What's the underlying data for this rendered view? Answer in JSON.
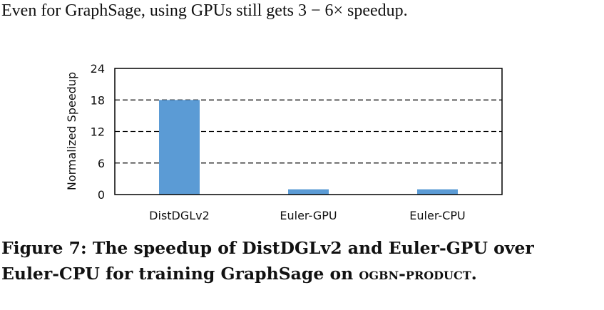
{
  "body_text": "Even for GraphSage, using GPUs still gets 3 − 6× speedup.",
  "caption": {
    "line1": "Figure 7: The speedup of DistDGLv2 and Euler-GPU over",
    "line2_prefix": "Euler-CPU for training GraphSage on ",
    "dataset": "ogbn-product",
    "line2_suffix": "."
  },
  "chart_data": {
    "type": "bar",
    "categories": [
      "DistDGLv2",
      "Euler-GPU",
      "Euler-CPU"
    ],
    "values": [
      18,
      1,
      1
    ],
    "title": "",
    "xlabel": "",
    "ylabel": "Normalized Speedup",
    "ylim": [
      0,
      24
    ],
    "yticks": [
      0,
      6,
      12,
      18,
      24
    ],
    "grid": "dashed horizontal",
    "bar_color": "#5b9bd5"
  }
}
